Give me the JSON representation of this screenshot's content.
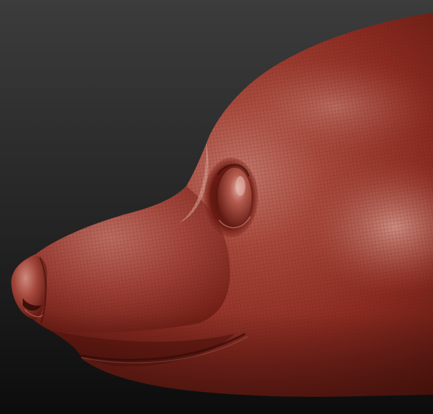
{
  "scene": {
    "subject": "sculpted-animal-head-profile",
    "material": "red-wax-clay",
    "colors": {
      "background_top": "#3a3a3a",
      "background_bottom": "#0e0e0e",
      "clay_base": "#8e2a20",
      "clay_mid": "#a9473a",
      "clay_light": "#c98478",
      "clay_shadow": "#4a120c",
      "wireframe": "#5e1a12"
    },
    "wireframe_visible": true
  }
}
